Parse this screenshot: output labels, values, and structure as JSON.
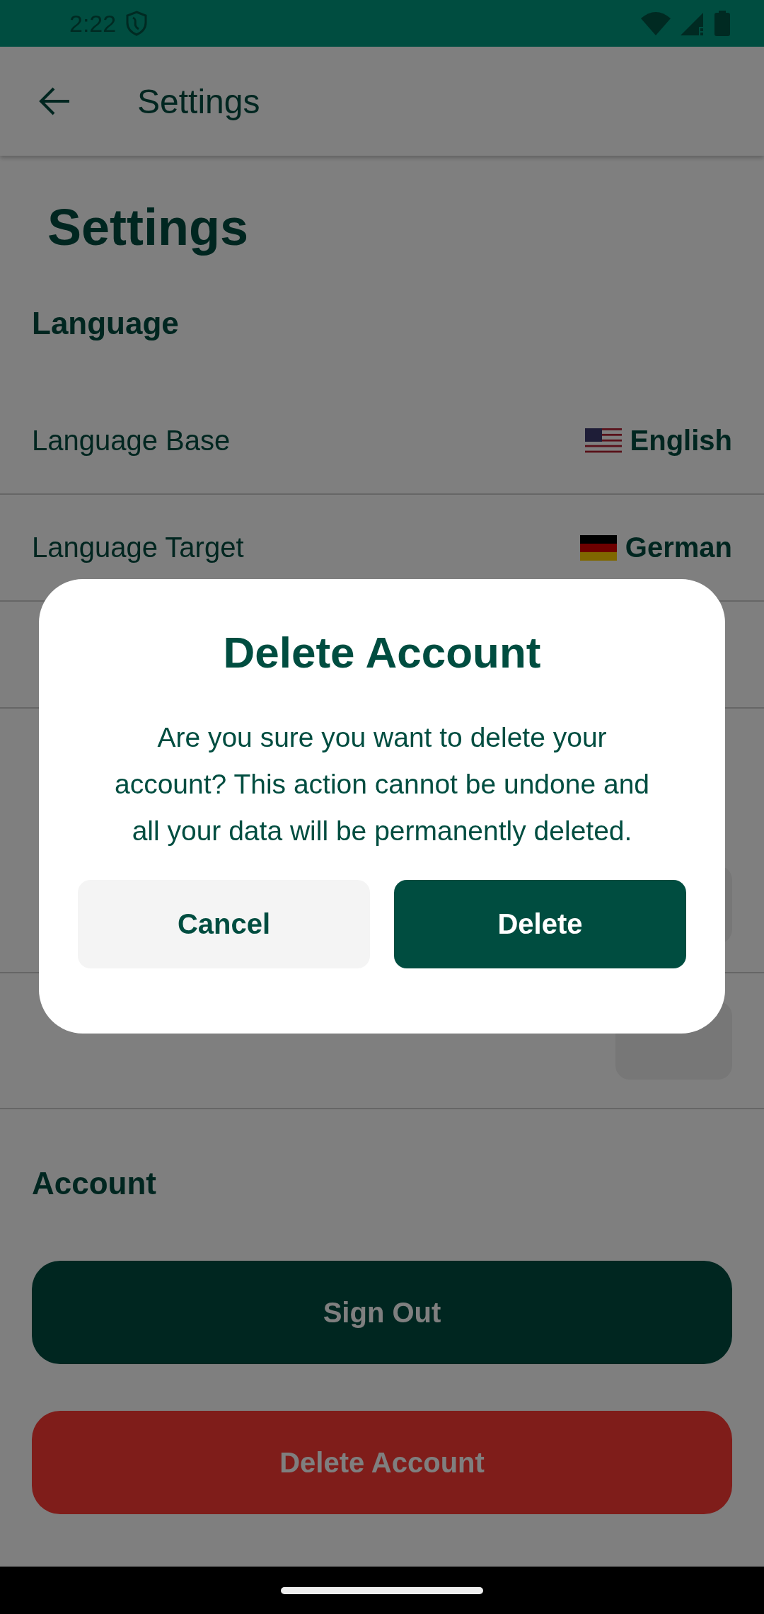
{
  "status_bar": {
    "time": "2:22"
  },
  "app_bar": {
    "title": "Settings"
  },
  "page_title": "Settings",
  "sections": [
    {
      "title": "Language",
      "rows": [
        {
          "label": "Language Base",
          "value": "English",
          "kind": "flag_us"
        },
        {
          "label": "Language Target",
          "value": "German",
          "kind": "flag_de"
        },
        {
          "kind": "blank"
        }
      ]
    },
    {
      "rows": [
        {
          "kind": "box"
        },
        {
          "kind": "box"
        }
      ]
    },
    {
      "title": "Account"
    }
  ],
  "account_buttons": [
    {
      "label": "Sign Out",
      "kind": "primary"
    },
    {
      "label": "Delete Account",
      "kind": "danger"
    }
  ],
  "dialog": {
    "title": "Delete Account",
    "message": "Are you sure you want to delete your account? This action cannot be undone and all your data will be permanently deleted.",
    "buttons": [
      {
        "label": "Cancel",
        "kind": "secondary"
      },
      {
        "label": "Delete",
        "kind": "primary"
      }
    ]
  }
}
